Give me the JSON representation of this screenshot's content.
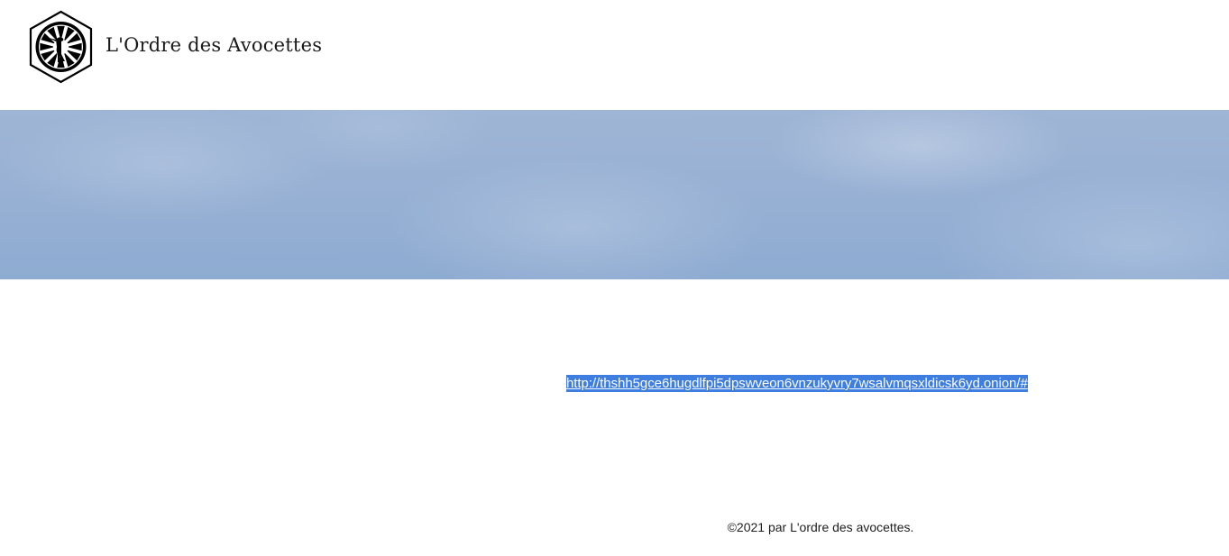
{
  "header": {
    "site_title": "L'Ordre des Avocettes",
    "logo_icon": "avocet-hexagon-emblem-icon"
  },
  "banner": {
    "colors": {
      "sky_top": "#9fb5d5",
      "sky_bottom": "#8eabd1"
    }
  },
  "main": {
    "link_text": "http://thshh5gce6hugdlfpi5dpswveon6vnzukyvry7wsalvmqsxldicsk6yd.onion/#",
    "selection_color": "#3e7ee0"
  },
  "footer": {
    "copyright": "©2021 par L'ordre des avocettes."
  }
}
